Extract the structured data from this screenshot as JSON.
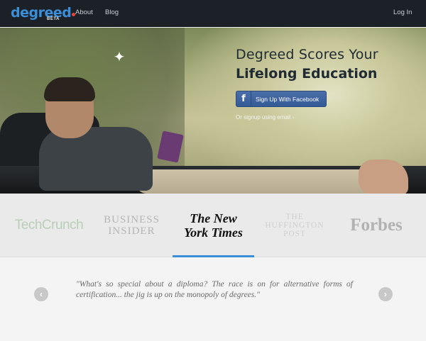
{
  "nav": {
    "logo_text": "degreed",
    "beta_badge": "BETA",
    "about": "About",
    "blog": "Blog",
    "login": "Log In"
  },
  "hero": {
    "headline_line1": "Degreed Scores Your",
    "headline_line2": "Lifelong Education",
    "facebook_icon_glyph": "f",
    "facebook_button": "Sign Up With Facebook",
    "email_link": "Or signup using email ›"
  },
  "press": {
    "items": [
      "TechCrunch",
      "BUSINESS",
      "INSIDER",
      "The New",
      "York Times",
      "THE",
      "HUFFINGTON",
      "POST",
      "Forbes"
    ],
    "selected": "The New York Times"
  },
  "quote": {
    "text": "\"What's so special about a diploma? The race is on for alternative forms of certification... the jig is up on the monopoly of degrees.\"",
    "prev_glyph": "‹",
    "next_glyph": "›"
  },
  "colors": {
    "accent": "#3a8fd8",
    "navbar": "#1c2128",
    "facebook": "#3b5998",
    "logo_dot": "#e8443a"
  },
  "icons": {
    "sparkle": "sparkle-icon",
    "facebook": "facebook-icon",
    "prev": "chevron-left-icon",
    "next": "chevron-right-icon"
  }
}
